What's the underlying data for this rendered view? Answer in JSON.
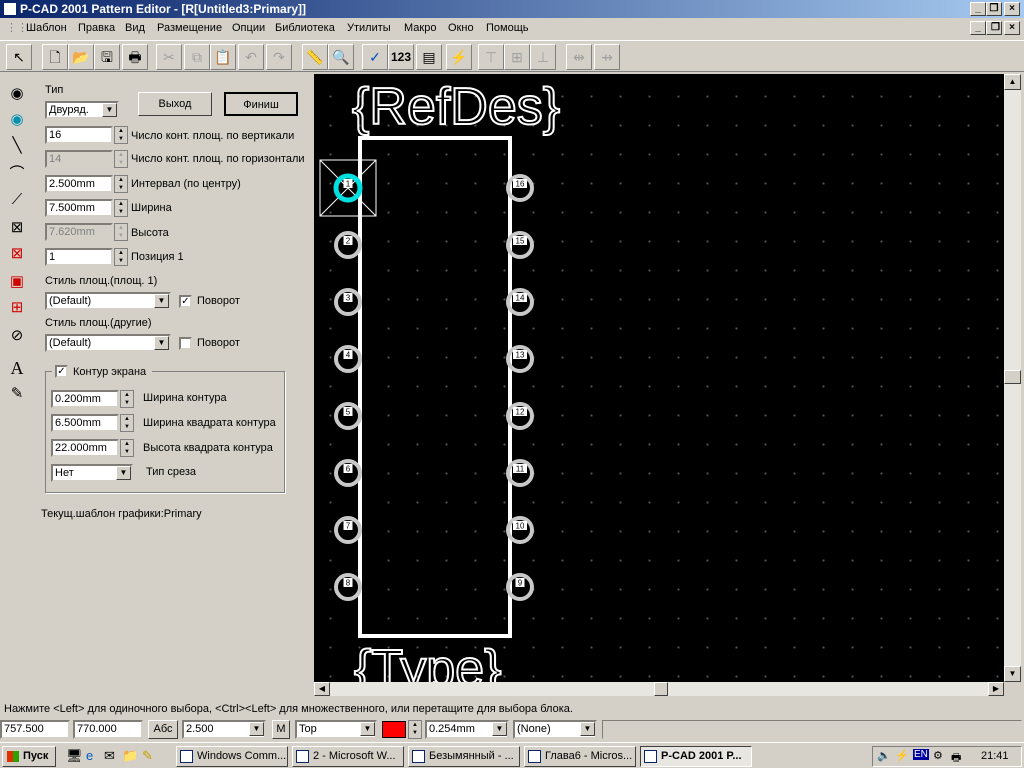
{
  "window": {
    "title": "P-CAD 2001 Pattern Editor - [R[Untitled3:Primary]]",
    "controls": [
      "_",
      "❐",
      "×"
    ]
  },
  "menu": [
    "Шаблон",
    "Правка",
    "Вид",
    "Размещение",
    "Опции",
    "Библиотека",
    "Утилиты",
    "Макро",
    "Окно",
    "Помощь"
  ],
  "toolbar": {
    "check_icon": "✓",
    "numbering_label": "123"
  },
  "left_tools": [
    "pad-tool-icon",
    "via-tool-icon",
    "line-tool-icon",
    "arc-tool-icon",
    "polygon-tool-icon",
    "cutout-tool-icon",
    "keepout-tool-icon",
    "component-tool-icon",
    "grid-tool-icon",
    "prohibit-tool-icon",
    "text-tool-icon",
    "attribute-tool-icon"
  ],
  "left_text_tool_label": "A",
  "panel": {
    "type_label": "Тип",
    "type_value": "Двуряд.",
    "exit_button": "Выход",
    "finish_button": "Финиш",
    "pads_vertical_value": "16",
    "pads_vertical_label": "Число конт. площ. по вертикали",
    "pads_horizontal_value": "14",
    "pads_horizontal_label": "Число конт. площ. по горизонтали",
    "pitch_value": "2.500mm",
    "pitch_label": "Интервал (по центру)",
    "width_value": "7.500mm",
    "width_label": "Ширина",
    "height_value": "7.620mm",
    "height_label": "Высота",
    "pin1_value": "1",
    "pin1_label": "Позиция 1",
    "pad_style1_label": "Стиль площ.(площ. 1)",
    "pad_style1_value": "(Default)",
    "rotate1_label": "Поворот",
    "rotate1_checked": "✓",
    "pad_style_other_label": "Стиль площ.(другие)",
    "pad_style_other_value": "(Default)",
    "rotate2_label": "Поворот",
    "outline_checked": "✓",
    "outline_label": "Контур экрана",
    "outline_width_value": "0.200mm",
    "outline_width_label": "Ширина контура",
    "outline_sq_width_value": "6.500mm",
    "outline_sq_width_label": "Ширина квадрата контура",
    "outline_sq_height_value": "22.000mm",
    "outline_sq_height_label": "Высота квадрата контура",
    "cut_type_value": "Нет",
    "cut_type_label": "Тип среза",
    "current_template": "Текущ.шаблон графики:Primary"
  },
  "canvas": {
    "refdes_text": "{RefDes}",
    "type_text": "{Type}",
    "left_pins": [
      "1",
      "2",
      "3",
      "4",
      "5",
      "6",
      "7",
      "8"
    ],
    "right_pins": [
      "16",
      "15",
      "14",
      "13",
      "12",
      "11",
      "10",
      "9"
    ]
  },
  "status_text": "Нажмите <Left> для одиночного выбора, <Ctrl><Left> для множественного, или перетащите для выбора блока.",
  "bottom": {
    "x_coord": "757.500",
    "y_coord": "770.000",
    "abs_button": "Абс",
    "grid_value": "2.500",
    "m_button": "M",
    "layer_value": "Top",
    "layer_color": "#ff0000",
    "line_width_value": "0.254mm",
    "none_value": "(None)"
  },
  "taskbar": {
    "start_label": "Пуск",
    "tasks": [
      "Windows Comm...",
      "2 - Microsoft W...",
      "Безымянный - ...",
      "Глава6 - Micros...",
      "P-CAD 2001 P..."
    ],
    "lang": "EN",
    "clock": "21:41"
  },
  "colors": {
    "title_start": "#0a246a",
    "title_end": "#a6caf0",
    "canvas_bg": "#000000",
    "pad_ring": "#c8c8c8",
    "selected_pad": "#00e0e0",
    "outline": "#ffffff"
  }
}
